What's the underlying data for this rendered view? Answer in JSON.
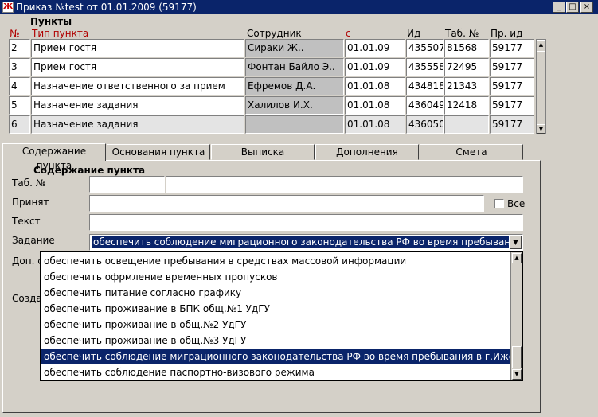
{
  "window": {
    "title": "Приказ №test от 01.01.2009 (59177)",
    "icon_text": "Ж"
  },
  "window_buttons": {
    "minimize": "_",
    "maximize": "□",
    "close": "×"
  },
  "points": {
    "section_title": "Пункты",
    "columns": {
      "num": "№",
      "type": "Тип пункта",
      "employee": "Сотрудник",
      "date": "с",
      "id": "Ид",
      "tab_num": "Таб. №",
      "pr_id": "Пр. ид"
    },
    "rows": [
      {
        "num": "2",
        "type": "Прием гостя",
        "employee": "Сираки Ж..",
        "date": "01.01.09",
        "id": "435507",
        "tab_num": "81568",
        "pr_id": "59177"
      },
      {
        "num": "3",
        "type": "Прием гостя",
        "employee": "Фонтан Байло Э..",
        "date": "01.01.09",
        "id": "435558",
        "tab_num": "72495",
        "pr_id": "59177"
      },
      {
        "num": "4",
        "type": "Назначение ответственного за прием",
        "employee": "Ефремов Д.А.",
        "date": "01.01.08",
        "id": "434818",
        "tab_num": "21343",
        "pr_id": "59177"
      },
      {
        "num": "5",
        "type": "Назначение задания",
        "employee": "Халилов И.Х.",
        "date": "01.01.08",
        "id": "436049",
        "tab_num": "12418",
        "pr_id": "59177"
      },
      {
        "num": "6",
        "type": "Назначение задания",
        "employee": "",
        "date": "01.01.08",
        "id": "436050",
        "tab_num": "",
        "pr_id": "59177"
      }
    ]
  },
  "tabs": [
    "Содержание пункта",
    "Основания пункта",
    "Выписка",
    "Дополнения",
    "Смета"
  ],
  "content": {
    "section_title": "Содержание пункта",
    "tab_num_label": "Таб. №",
    "accepted_label": "Принят",
    "all_checkbox_label": "Все",
    "text_label": "Текст",
    "task_label": "Задание",
    "task_value": "обеспечить соблюдение миграционного законодательства РФ во время пребывания в",
    "extra_label": "Доп. с",
    "created_label": "Созда"
  },
  "task_options": [
    "обеспечить освещение пребывания в средствах массовой информации",
    "обеспечить офрмление временных пропусков",
    "обеспечить питание согласно графику",
    "обеспечить проживание в БПК общ.№1 УдГУ",
    "обеспечить проживание в общ.№2 УдГУ",
    "обеспечить проживание в общ.№3 УдГУ",
    "обеспечить соблюдение миграционного законодательства РФ во время пребывания в г.Ижевске",
    "обеспечить соблюдение паспортно-визового режима"
  ],
  "task_selected_index": 6,
  "colors": {
    "title_bar": "#0a246a",
    "header_red": "#b00000",
    "selection": "#0a246a",
    "window_bg": "#d4d0c8"
  }
}
